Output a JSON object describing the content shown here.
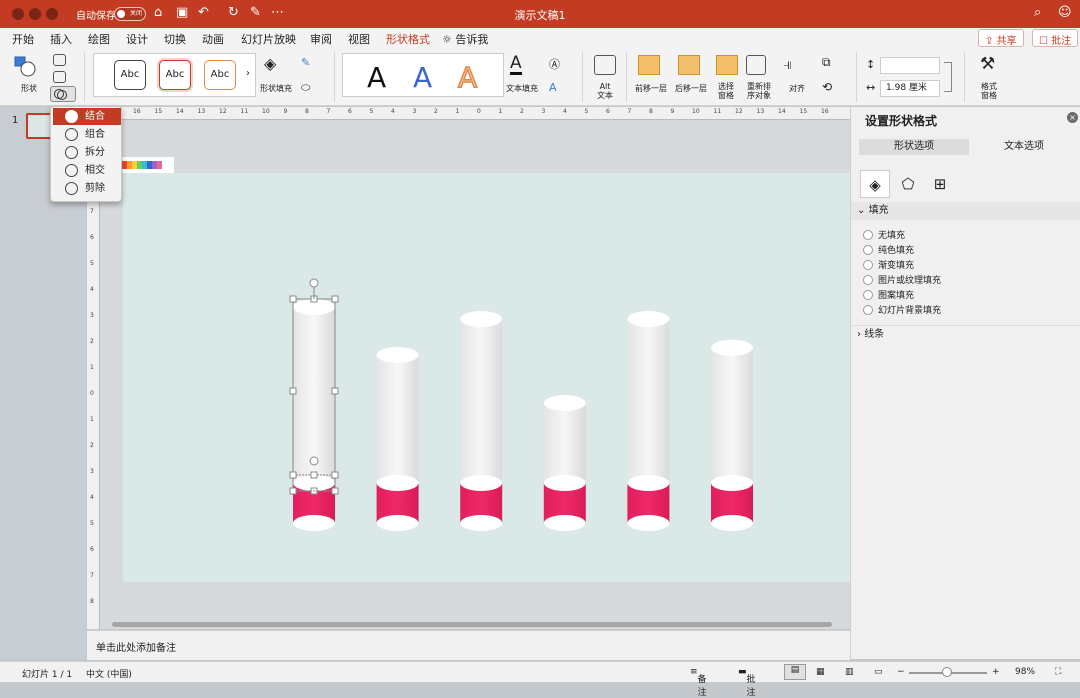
{
  "titlebar": {
    "autosave": "自动保存",
    "toggle": "关闭",
    "title": "演示文稿1"
  },
  "tabs": [
    "开始",
    "插入",
    "绘图",
    "设计",
    "切换",
    "动画",
    "幻灯片放映",
    "审阅",
    "视图",
    "形状格式",
    "告诉我"
  ],
  "active_tab": "形状格式",
  "share": {
    "share_label": "共享",
    "comment_label": "批注"
  },
  "ribbon": {
    "shapes_label": "形状",
    "style_samples": [
      "Abc",
      "Abc",
      "Abc"
    ],
    "shape_fill_label": "形状填充",
    "wordart_letters": [
      "A",
      "A",
      "A"
    ],
    "text_fill_label": "文本填充",
    "alt_text_label": "Alt\n文本",
    "bring_forward_label": "前移一层",
    "send_backward_label": "后移一层",
    "selection_pane_label": "选择\n窗格",
    "reorder_label": "重新排\n序对象",
    "align_label": "对齐",
    "width_value": "1.98 厘米",
    "format_pane_label": "格式\n窗格"
  },
  "merge_menu": [
    {
      "label": "结合",
      "icon": "combine-icon"
    },
    {
      "label": "组合",
      "icon": "union-icon"
    },
    {
      "label": "拆分",
      "icon": "fragment-icon"
    },
    {
      "label": "相交",
      "icon": "intersect-icon"
    },
    {
      "label": "剪除",
      "icon": "subtract-icon"
    }
  ],
  "slide_panel": {
    "slide_number": "1"
  },
  "ruler": {
    "h": [
      "16",
      "15",
      "14",
      "13",
      "12",
      "11",
      "10",
      "9",
      "8",
      "7",
      "6",
      "5",
      "4",
      "3",
      "2",
      "1",
      "0",
      "1",
      "2",
      "3",
      "4",
      "5",
      "6",
      "7",
      "8",
      "9",
      "10",
      "11",
      "12",
      "13",
      "14",
      "15",
      "16"
    ],
    "v": [
      "8",
      "7",
      "6",
      "5",
      "4",
      "3",
      "2",
      "1",
      "0",
      "1",
      "2",
      "3",
      "4",
      "5",
      "6",
      "7",
      "8"
    ]
  },
  "slide": {
    "background": "#dbe8e8",
    "accent": "#f0286a",
    "cylinders": [
      {
        "height_cm": 9.0,
        "selected": true
      },
      {
        "height_cm": 7.0,
        "selected": false
      },
      {
        "height_cm": 8.5,
        "selected": false
      },
      {
        "height_cm": 5.0,
        "selected": false
      },
      {
        "height_cm": 8.5,
        "selected": false
      },
      {
        "height_cm": 7.3,
        "selected": false
      }
    ]
  },
  "notes_placeholder": "单击此处添加备注",
  "format_panel": {
    "title": "设置形状格式",
    "tabs": [
      "形状选项",
      "文本选项"
    ],
    "icons": [
      "fill-line-icon",
      "effects-icon",
      "size-properties-icon"
    ],
    "fill_section": "填充",
    "fill_options": [
      "无填充",
      "纯色填充",
      "渐变填充",
      "图片或纹理填充",
      "图案填充",
      "幻灯片背景填充"
    ],
    "line_section": "线条"
  },
  "status": {
    "slide": "幻灯片 1 / 1",
    "language": "中文 (中国)",
    "notes": "备注",
    "comments": "批注",
    "zoom": "98%"
  },
  "colors": {
    "titlebar": "#c23b22",
    "accent": "#c23b22"
  }
}
